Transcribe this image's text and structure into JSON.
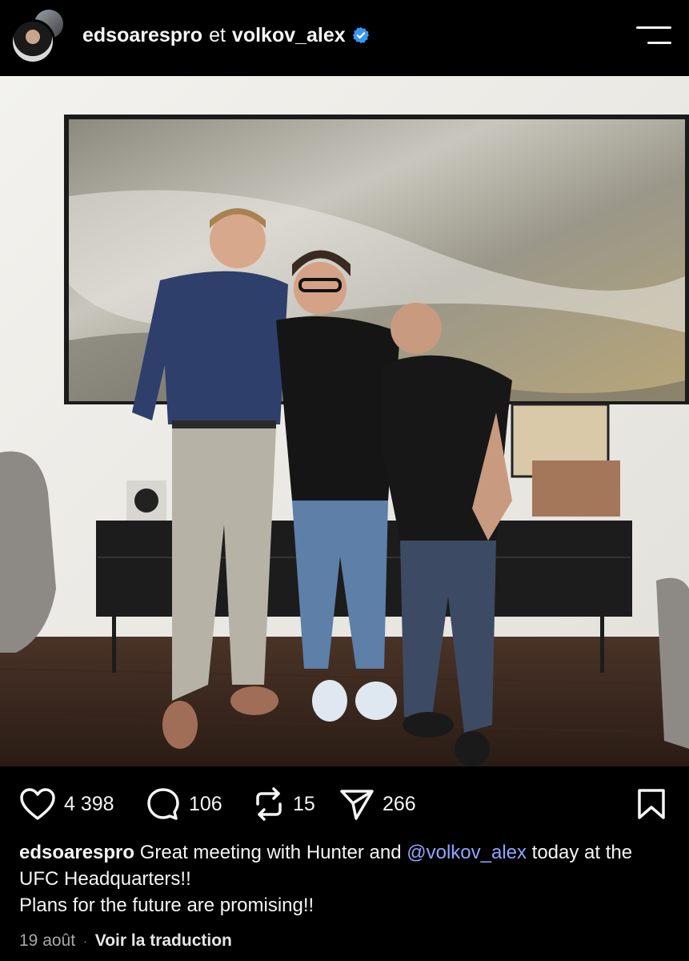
{
  "header": {
    "user_primary": "edsoarespro",
    "joiner": "et",
    "user_secondary": "volkov_alex",
    "verified_icon": "verified-badge-icon",
    "menu_icon": "hamburger-menu-icon"
  },
  "actions": {
    "likes": "4 398",
    "comments": "106",
    "reposts": "15",
    "shares": "266"
  },
  "caption": {
    "username": "edsoarespro",
    "text_1": " Great meeting with Hunter and ",
    "mention": "@volkov_alex",
    "text_2": " today at the UFC Headquarters!!",
    "line_2": "Plans for the future are promising!!"
  },
  "meta": {
    "date": "19 août",
    "separator": "·",
    "translate_label": "Voir la traduction"
  },
  "colors": {
    "background": "#000000",
    "verified": "#3897f0",
    "mention": "#8fa6ff"
  }
}
